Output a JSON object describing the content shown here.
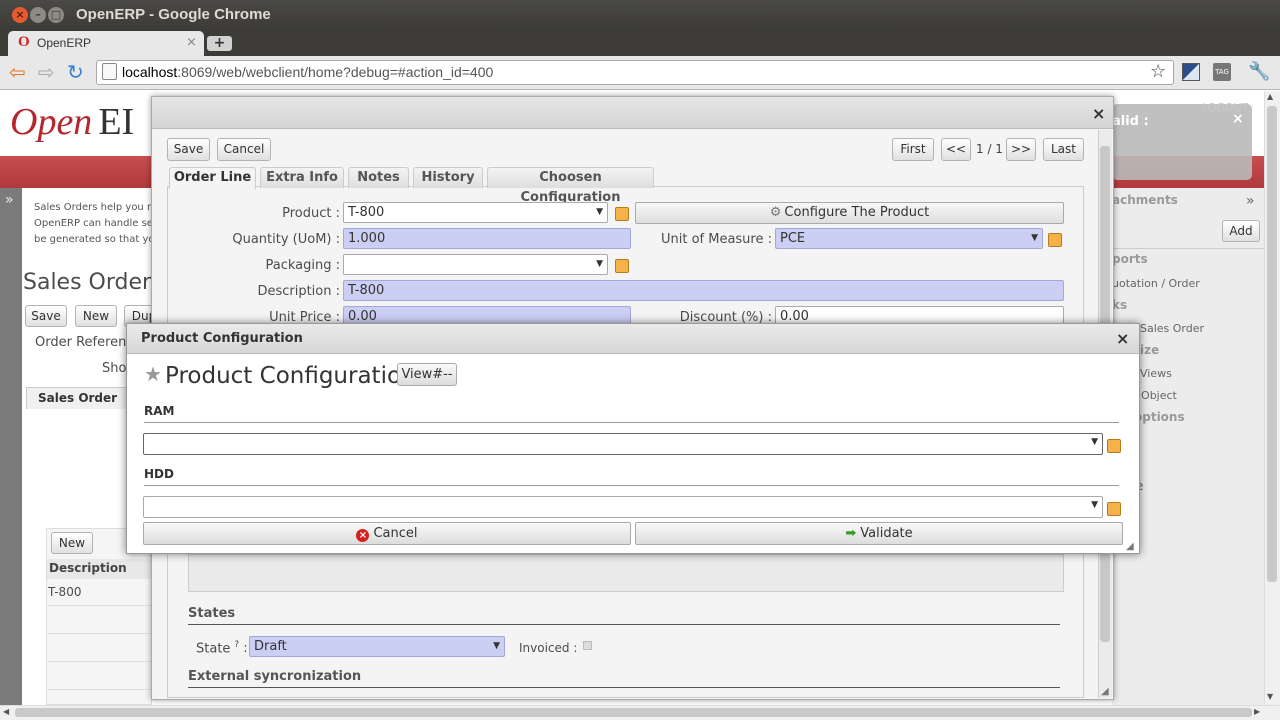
{
  "window": {
    "title": "OpenERP - Google Chrome"
  },
  "tab": {
    "label": "OpenERP",
    "icon": "O"
  },
  "address_bar": {
    "host": "localhost",
    "rest": ":8069/web/webclient/home?debug=#action_id=400"
  },
  "app": {
    "logo_text": "Open",
    "logo_text2": "EI",
    "help_text": [
      "Sales Orders help you m",
      "OpenERP can handle se",
      "be generated so that yo"
    ],
    "page_title": "Sales Orders",
    "buttons": {
      "save": "Save",
      "new": "New",
      "dup": "Dup"
    },
    "order_ref_label": "Order Reference",
    "sho_label": "Sho",
    "sales_order_tab": "Sales Order",
    "lines_new": "New",
    "lines_header": "Description",
    "lines_value": "T-800"
  },
  "right_panel": {
    "invalid_text": "alid :",
    "invalid_close": "×",
    "logout": "LOGOUT",
    "attachments": "achments",
    "add": "Add",
    "reports": "ports",
    "report1": "uotation / Order",
    "links": "ks",
    "link1": "Sales Order",
    "customize": "ize",
    "views": "Views",
    "obj": "ze Object",
    "options": "options",
    "collapse": "»",
    "e_char": "e"
  },
  "dialog1": {
    "close": "×",
    "save": "Save",
    "cancel": "Cancel",
    "pager": {
      "first": "First",
      "prev": "<<",
      "count": "1 / 1",
      "next": ">>",
      "last": "Last"
    },
    "tabs": [
      "Order Line",
      "Extra Info",
      "Notes",
      "History",
      "Choosen Configuration"
    ],
    "fields": {
      "product_label": "Product :",
      "product_value": "T-800",
      "configure_button": "Configure The Product",
      "qty_label": "Quantity (UoM) :",
      "qty_value": "1.000",
      "uom_label": "Unit of Measure :",
      "uom_value": "PCE",
      "packaging_label": "Packaging :",
      "desc_label": "Description :",
      "desc_value": "T-800",
      "price_label": "Unit Price :",
      "price_value": "0.00",
      "discount_label": "Discount (%) :",
      "discount_value": "0.00"
    },
    "states_section": "States",
    "state_label": "State",
    "state_help": "?",
    "state_colon": ":",
    "state_value": "Draft",
    "invoiced_label": "Invoiced :",
    "ext_section": "External syncronization"
  },
  "dialog2": {
    "title": "Product Configuration",
    "heading": "Product Configuration",
    "view_button": "View#--",
    "close": "×",
    "ram_label": "RAM",
    "hdd_label": "HDD",
    "cancel": "Cancel",
    "validate": "Validate"
  }
}
